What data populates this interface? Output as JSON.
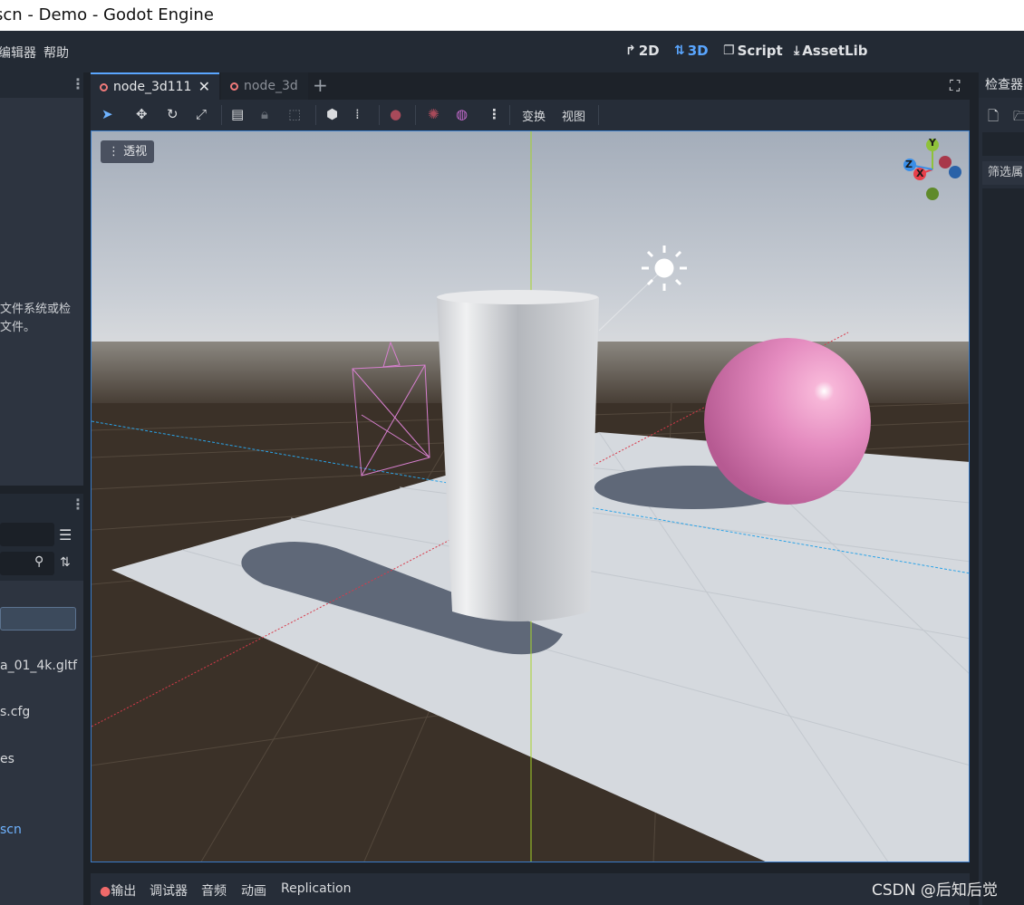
{
  "window": {
    "title": "scn - Demo - Godot Engine"
  },
  "menubar": {
    "items": [
      "编辑器",
      "帮助"
    ],
    "modes": [
      {
        "label": "2D",
        "icon": "2d-icon",
        "active": false
      },
      {
        "label": "3D",
        "icon": "3d-icon",
        "active": true
      },
      {
        "label": "Script",
        "icon": "script-icon",
        "active": false
      },
      {
        "label": "AssetLib",
        "icon": "assetlib-icon",
        "active": false
      }
    ]
  },
  "scene_dock": {
    "hint_line1": "文件系统或检",
    "hint_line2": "文件。"
  },
  "filesystem": {
    "items": [
      "a_01_4k.gltf",
      "s.cfg",
      "es",
      "scn"
    ]
  },
  "editor_tabs": [
    {
      "label": "node_3d111",
      "active": true
    },
    {
      "label": "node_3d",
      "active": false
    }
  ],
  "toolbar": {
    "transform_label": "变换",
    "view_label": "视图"
  },
  "viewport": {
    "perspective_label": "透视",
    "gizmo": {
      "x": "X",
      "y": "Y",
      "z": "Z"
    }
  },
  "bottom_panel": {
    "tabs": [
      "输出",
      "调试器",
      "音频",
      "动画",
      "Replication"
    ]
  },
  "inspector": {
    "title": "检查器",
    "filter_label": "筛选属"
  },
  "watermark": "CSDN @后知后觉",
  "colors": {
    "accent": "#5aa6ff",
    "sphere": "#e880b8",
    "floor": "#d5d9de",
    "ground": "#3b3128"
  }
}
